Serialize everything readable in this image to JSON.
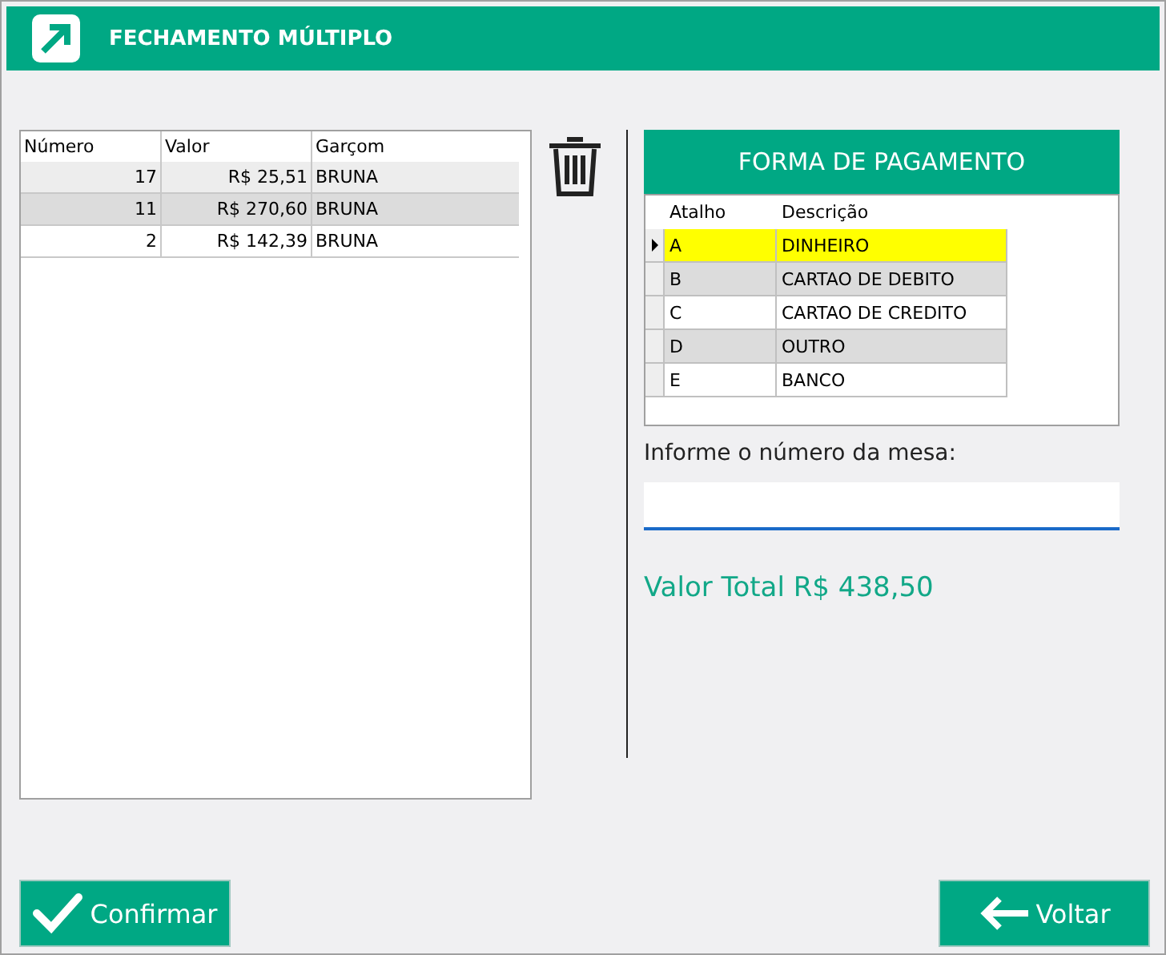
{
  "window": {
    "title": "FECHAMENTO MÚLTIPLO"
  },
  "orders": {
    "columns": [
      "Número",
      "Valor",
      "Garçom"
    ],
    "rows": [
      {
        "numero": "17",
        "valor": "R$ 25,51",
        "garcom": "BRUNA"
      },
      {
        "numero": "11",
        "valor": "R$ 270,60",
        "garcom": "BRUNA"
      },
      {
        "numero": "2",
        "valor": "R$ 142,39",
        "garcom": "BRUNA"
      }
    ]
  },
  "payment": {
    "title": "FORMA DE PAGAMENTO",
    "columns": [
      "Atalho",
      "Descrição"
    ],
    "rows": [
      {
        "atalho": "A",
        "descricao": "DINHEIRO",
        "selected": true
      },
      {
        "atalho": "B",
        "descricao": "CARTAO DE DEBITO",
        "selected": false
      },
      {
        "atalho": "C",
        "descricao": "CARTAO DE CREDITO",
        "selected": false
      },
      {
        "atalho": "D",
        "descricao": "OUTRO",
        "selected": false
      },
      {
        "atalho": "E",
        "descricao": "BANCO",
        "selected": false
      }
    ]
  },
  "table_field": {
    "label": "Informe o número da mesa:"
  },
  "total": "Valor Total R$ 438,50",
  "buttons": {
    "confirm": "Confirmar",
    "back": "Voltar"
  }
}
